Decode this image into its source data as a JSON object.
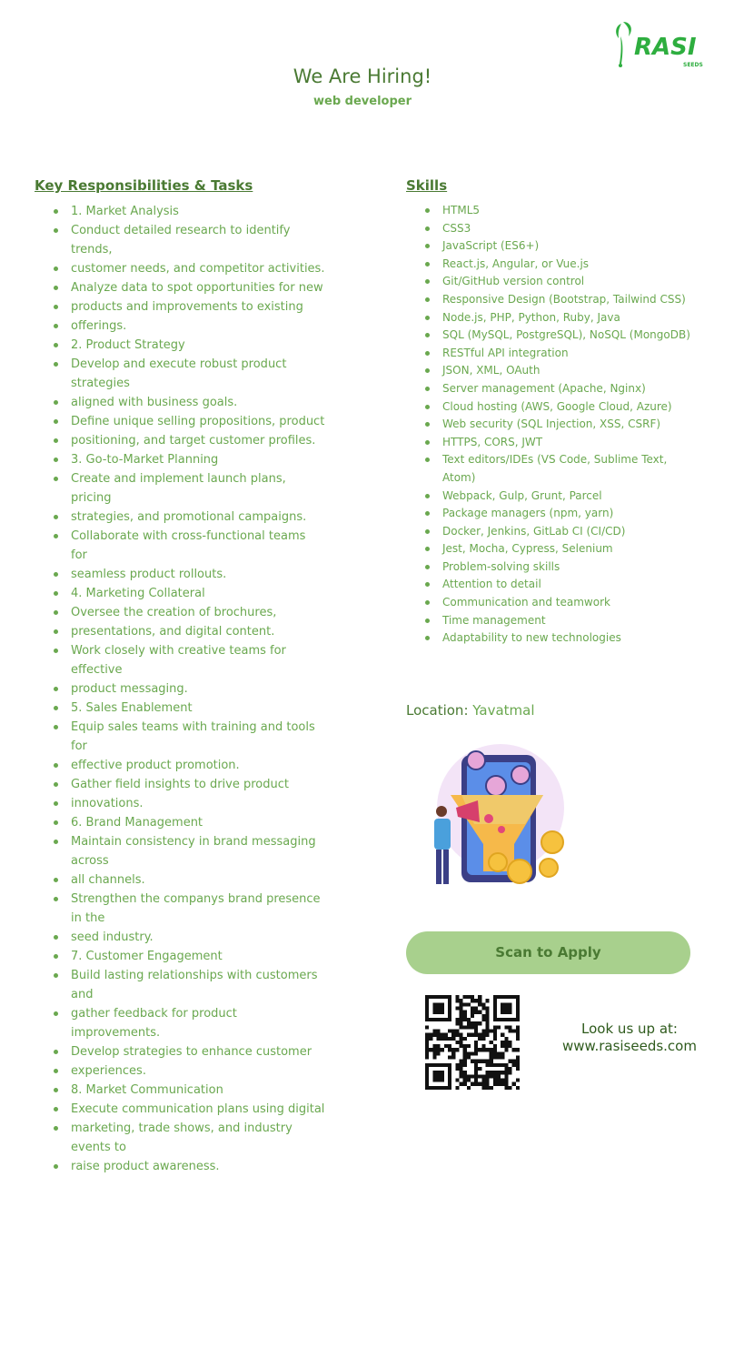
{
  "header": {
    "logo_text": "RASI",
    "logo_sub": "SEEDS",
    "title": "We Are Hiring!",
    "subtitle": "web developer"
  },
  "responsibilities": {
    "heading": "Key Responsibilities & Tasks",
    "items": [
      "1. Market Analysis",
      "Conduct detailed research to identify trends,",
      "customer needs, and competitor activities.",
      " Analyze data to spot opportunities for new",
      "products and improvements to existing",
      "offerings.",
      "2. Product Strategy",
      " Develop and execute robust product strategies",
      "aligned with business goals.",
      " Define unique selling propositions, product",
      "positioning, and target customer profiles.",
      "3. Go-to-Market Planning",
      "Create and implement launch plans, pricing",
      "strategies, and promotional campaigns.",
      " Collaborate with cross-functional teams for",
      "seamless product rollouts.",
      "4. Marketing Collateral",
      "Oversee the creation of brochures,",
      "presentations, and digital content.",
      "Work closely with creative teams for effective",
      "product messaging.",
      "5. Sales Enablement",
      "Equip sales teams with training and tools for",
      "effective product promotion.",
      "Gather field insights to drive product",
      "innovations.",
      "6. Brand Management",
      "Maintain consistency in brand messaging across",
      "all channels.",
      "Strengthen the companys brand presence in the",
      "seed industry.",
      "7. Customer Engagement",
      "Build lasting relationships with customers and",
      "gather feedback for product improvements.",
      "Develop strategies to enhance customer",
      "experiences.",
      "8. Market Communication",
      "Execute communication plans using digital",
      "marketing, trade shows, and industry events to",
      "raise product awareness."
    ]
  },
  "skills": {
    "heading": "Skills",
    "items": [
      "HTML5",
      "CSS3",
      "JavaScript (ES6+)",
      "React.js, Angular, or Vue.js",
      "Git/GitHub version control",
      "Responsive Design (Bootstrap, Tailwind CSS)",
      "Node.js, PHP, Python, Ruby, Java",
      "SQL (MySQL, PostgreSQL), NoSQL (MongoDB)",
      "RESTful API integration",
      "JSON, XML, OAuth",
      "Server management (Apache, Nginx)",
      "Cloud hosting (AWS, Google Cloud, Azure)",
      "Web security (SQL Injection, XSS, CSRF)",
      "HTTPS, CORS, JWT",
      "Text editors/IDEs (VS Code, Sublime Text, Atom)",
      "Webpack, Gulp, Grunt, Parcel",
      "Package managers (npm, yarn)",
      "Docker, Jenkins, GitLab CI (CI/CD)",
      "Jest, Mocha, Cypress, Selenium",
      "Problem-solving skills",
      "Attention to detail",
      "Communication and teamwork",
      "Time management",
      "Adaptability to new technologies"
    ]
  },
  "location": {
    "label": "Location:",
    "value": "Yavatmal"
  },
  "apply": {
    "button_label": "Scan to Apply"
  },
  "contact": {
    "line1": "Look us up at:",
    "line2": "www.rasiseeds.com"
  },
  "colors": {
    "dark_green": "#4a7a33",
    "light_green": "#6aa84f",
    "button_green": "#a8d08d",
    "logo_green": "#2eae3f"
  },
  "icons": [
    "rasi-seeds-logo",
    "marketing-funnel-illustration",
    "qr-code"
  ]
}
